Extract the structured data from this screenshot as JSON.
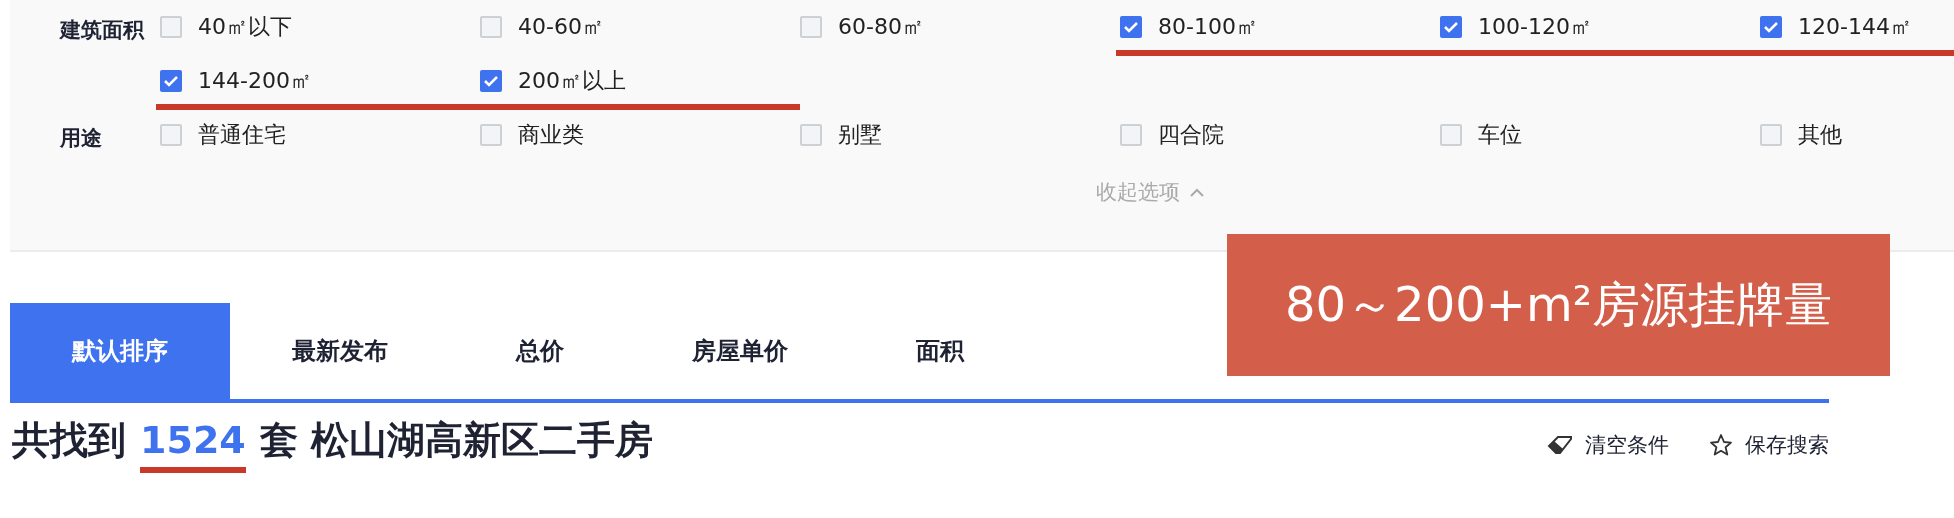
{
  "filters": [
    {
      "label": "建筑面积",
      "options": [
        {
          "text": "40㎡以下",
          "checked": false,
          "underlined": false
        },
        {
          "text": "40-60㎡",
          "checked": false,
          "underlined": false
        },
        {
          "text": "60-80㎡",
          "checked": false,
          "underlined": false
        },
        {
          "text": "80-100㎡",
          "checked": true,
          "underlined": true
        },
        {
          "text": "100-120㎡",
          "checked": true,
          "underlined": true
        },
        {
          "text": "120-144㎡",
          "checked": true,
          "underlined": true
        },
        {
          "text": "144-200㎡",
          "checked": true,
          "underlined": true
        },
        {
          "text": "200㎡以上",
          "checked": true,
          "underlined": true
        }
      ]
    },
    {
      "label": "用途",
      "options": [
        {
          "text": "普通住宅",
          "checked": false,
          "underlined": false
        },
        {
          "text": "商业类",
          "checked": false,
          "underlined": false
        },
        {
          "text": "别墅",
          "checked": false,
          "underlined": false
        },
        {
          "text": "四合院",
          "checked": false,
          "underlined": false
        },
        {
          "text": "车位",
          "checked": false,
          "underlined": false
        },
        {
          "text": "其他",
          "checked": false,
          "underlined": false
        }
      ]
    }
  ],
  "collapse": {
    "label": "收起选项",
    "expanded": true
  },
  "callout": "80～200+m²房源挂牌量",
  "tabs": [
    {
      "label": "默认排序",
      "selected": true
    },
    {
      "label": "最新发布",
      "selected": false
    },
    {
      "label": "总价",
      "selected": false
    },
    {
      "label": "房屋单价",
      "selected": false
    },
    {
      "label": "面积",
      "selected": false
    }
  ],
  "result": {
    "prefix": "共找到",
    "count": "1524",
    "count_underlined": true,
    "suffix": "套 松山湖高新区二手房"
  },
  "actions": [
    {
      "kind": "clear",
      "label": "清空条件"
    },
    {
      "kind": "save",
      "label": "保存搜索"
    }
  ]
}
